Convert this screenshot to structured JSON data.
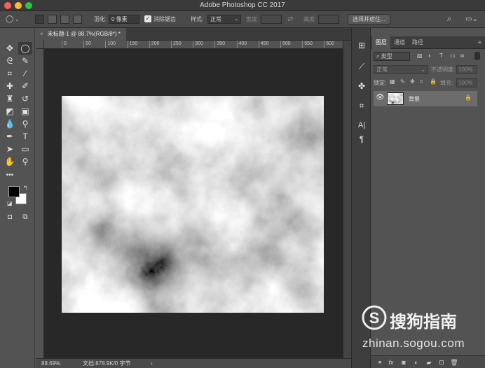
{
  "window": {
    "title": "Adobe Photoshop CC 2017"
  },
  "options_bar": {
    "feather_label": "羽化:",
    "feather_value": "0 像素",
    "antialias_label": "消除锯齿",
    "antialias_checked": true,
    "style_label": "样式:",
    "style_value": "正常",
    "width_label": "宽度:",
    "height_label": "高度:",
    "select_mask_button": "选择并遮住..."
  },
  "document": {
    "tab_label": "未标题-1 @ 88.7%(RGB/8*) *",
    "ruler_ticks": [
      "0",
      "50",
      "100",
      "150",
      "200",
      "250",
      "300",
      "350",
      "400",
      "450",
      "500",
      "550",
      "600"
    ]
  },
  "status_bar": {
    "zoom": "88.69%",
    "doc_info": "文档:878.9K/0 字节",
    "arrow": "›"
  },
  "layers_panel": {
    "tabs": [
      "图层",
      "通道",
      "路径"
    ],
    "active_tab": 0,
    "filter_kind": "类型",
    "blend_mode": "正常",
    "opacity_label": "不透明度:",
    "opacity_value": "100%",
    "lock_label": "锁定:",
    "fill_label": "填充:",
    "fill_value": "100%",
    "layers": [
      {
        "name": "背景",
        "locked": true,
        "visible": true
      }
    ]
  },
  "watermark": {
    "brand": "搜狗指南",
    "url": "zhinan.sogou.com"
  },
  "colors": {
    "foreground": "#000000",
    "background": "#ffffff",
    "app_bg": "#535353",
    "pasteboard": "#282828"
  }
}
